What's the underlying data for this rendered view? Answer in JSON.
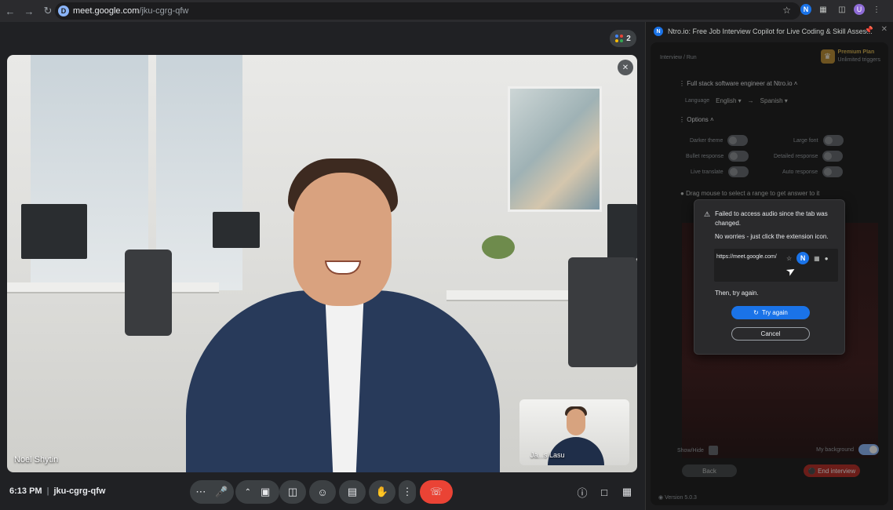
{
  "browser": {
    "url_host": "meet.google.com",
    "url_path": "/jku-cgrg-qfw",
    "favicon_letter": "D",
    "extension_letter": "N",
    "profile_letter": "U"
  },
  "meet": {
    "participant_count": "2",
    "main_participant_name": "Noel Shytin",
    "self_name": "Ja...s Lasu",
    "time": "6:13 PM",
    "meeting_code": "jku-cgrg-qfw",
    "end_call_color": "#ea4335"
  },
  "panel": {
    "title": "Ntro.io: Free Job Interview Copilot for Live Coding & Skill Asses...",
    "breadcrumb": "Interview / Run",
    "premium_title": "Premium Plan",
    "premium_sub": "Unlimited triggers",
    "job_title": "Full stack software engineer at Ntro.io",
    "language_label": "Language",
    "language_from": "English",
    "language_to": "Spanish",
    "options_title": "Options",
    "options": {
      "darker_theme": "Darker theme",
      "large_font": "Large font",
      "bullet_response": "Bullet response",
      "detailed_response": "Detailed response",
      "live_translate": "Live translate",
      "auto_response": "Auto response"
    },
    "drag_hint": "Drag mouse to select a range to get answer to it",
    "show_hide": "Show/Hide",
    "my_background": "My background",
    "back": "Back",
    "end_interview": "End interview",
    "version": "Version 5.0.3"
  },
  "modal": {
    "message": "Failed to access audio since the tab was changed.",
    "sub": "No worries - just click the extension icon.",
    "fake_url": "https://meet.google.com/",
    "then": "Then, try again.",
    "try_again": "Try again",
    "cancel": "Cancel",
    "accent": "#1a73e8"
  }
}
